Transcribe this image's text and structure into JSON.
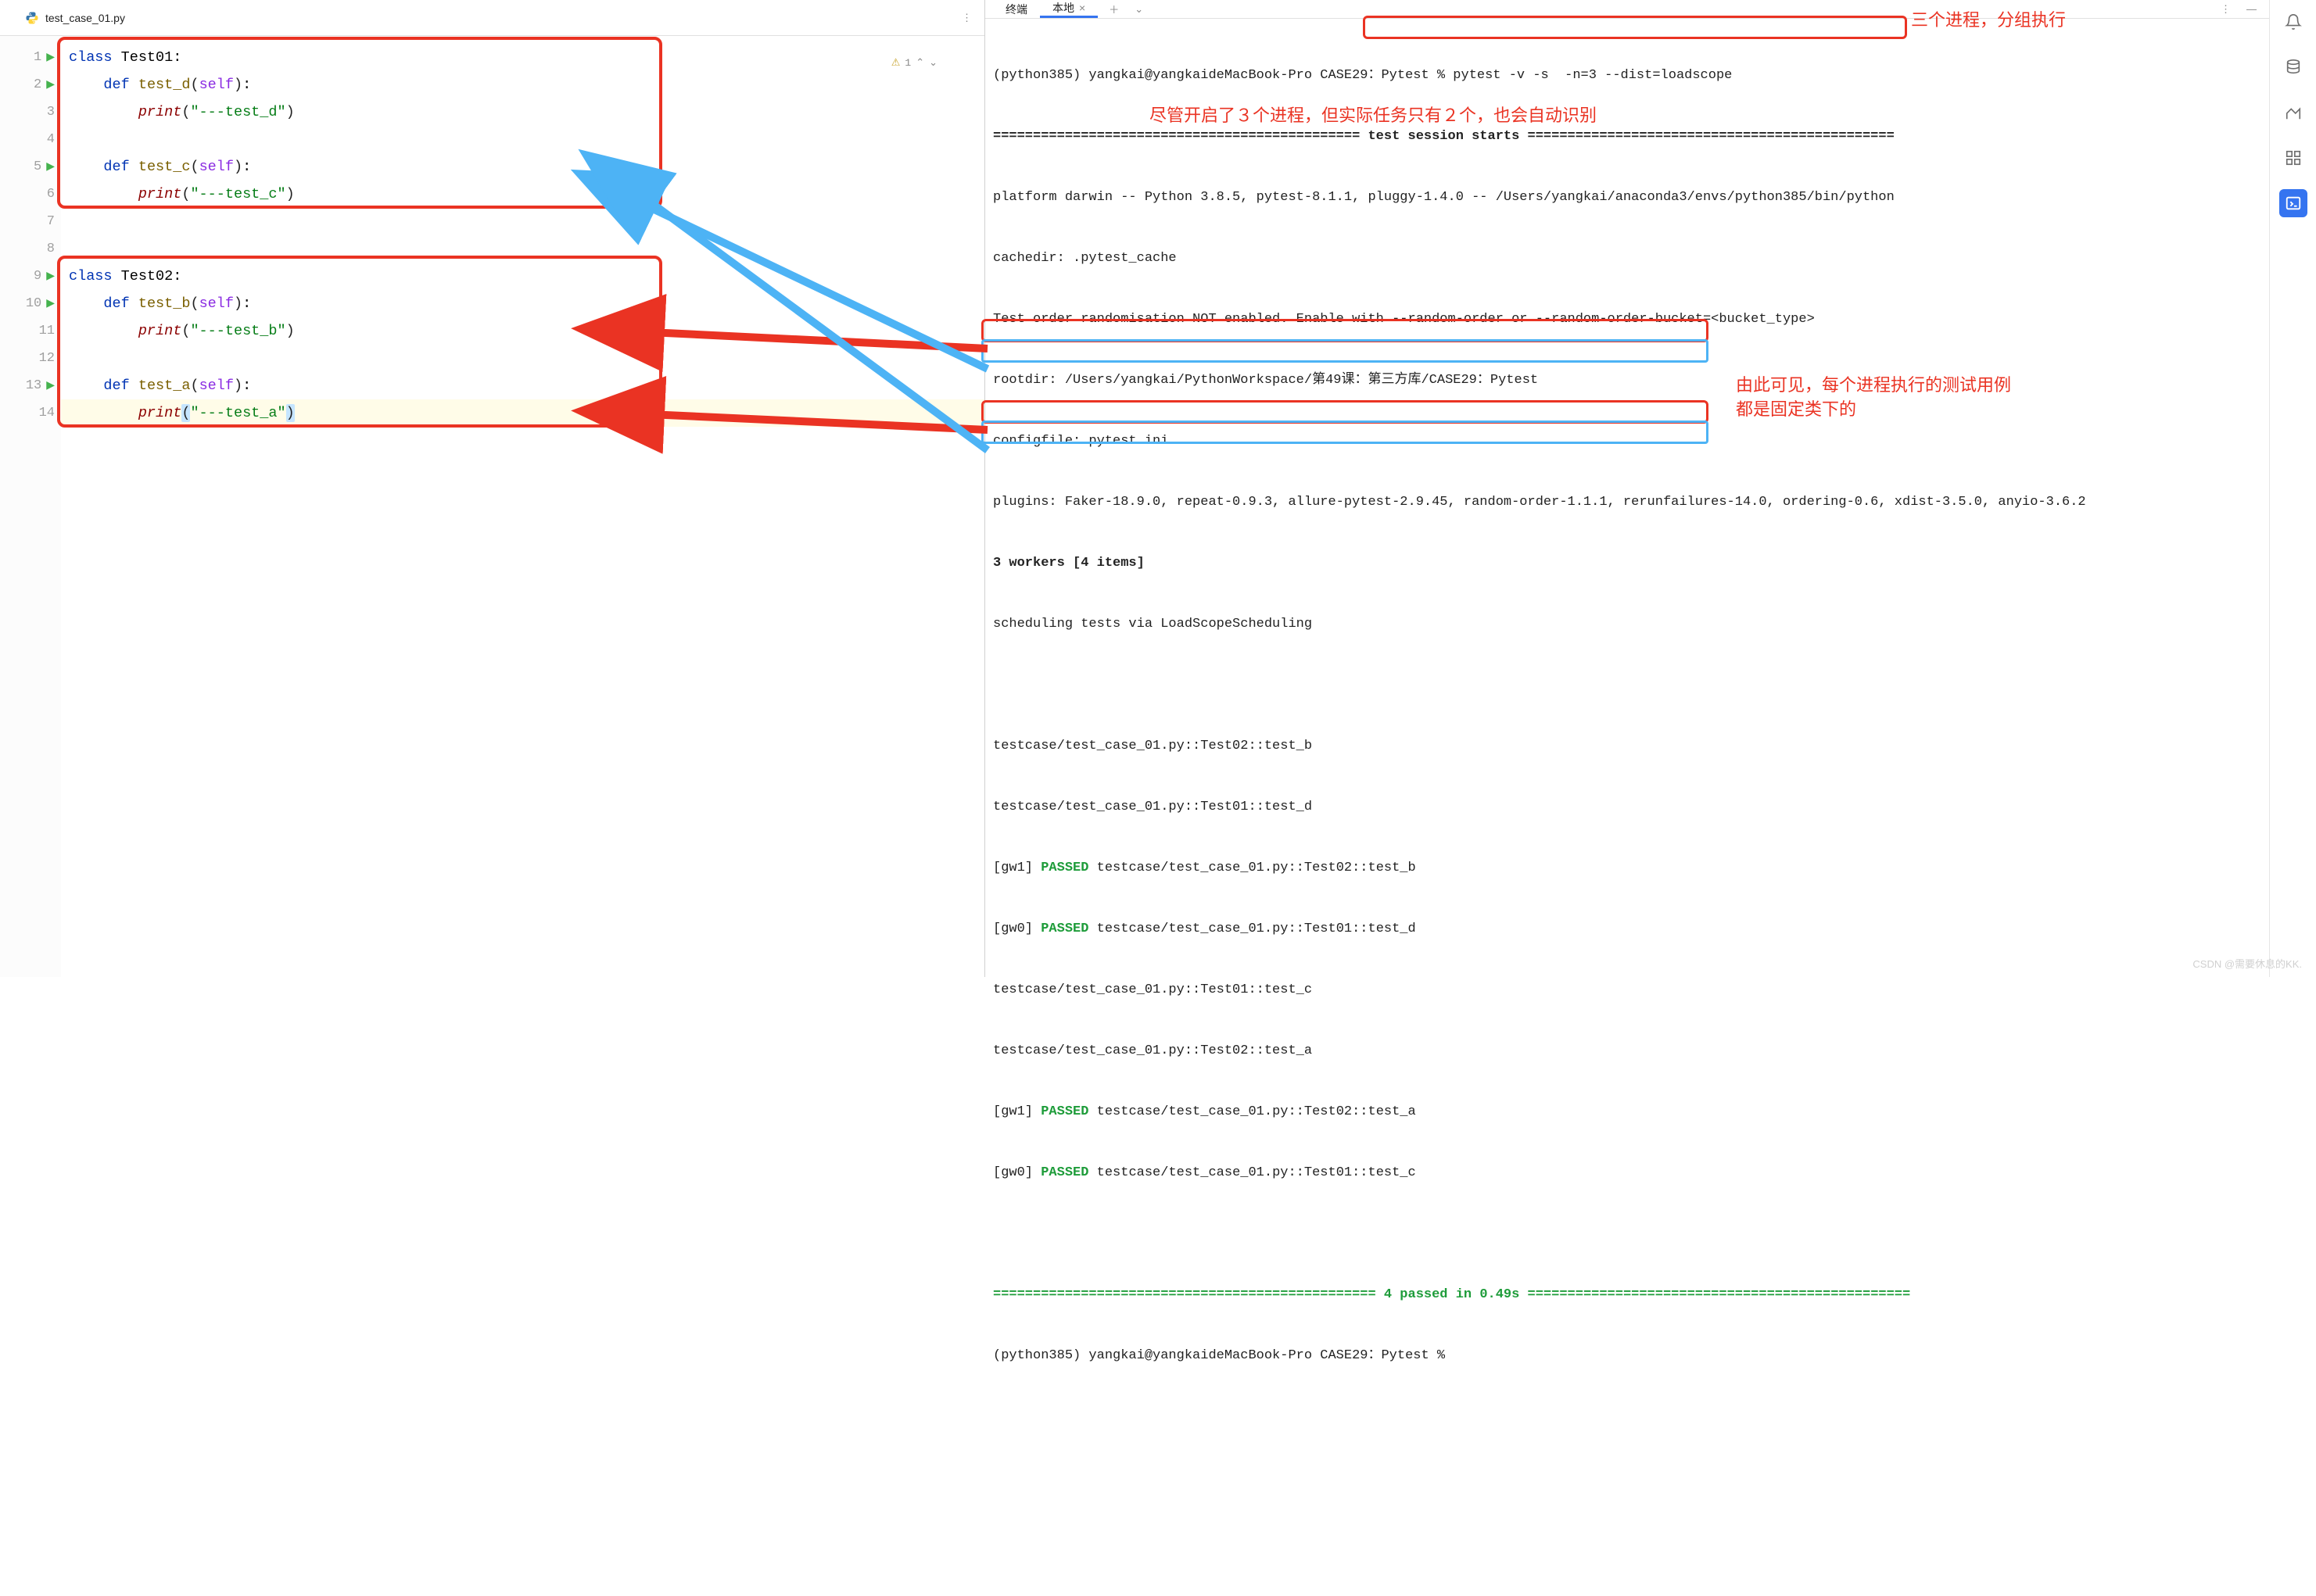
{
  "left": {
    "tab_name": "test_case_01.py",
    "inspection_count": "1",
    "lines": [
      {
        "num": "1",
        "runnable": true
      },
      {
        "num": "2",
        "runnable": true
      },
      {
        "num": "3",
        "runnable": false
      },
      {
        "num": "4",
        "runnable": false
      },
      {
        "num": "5",
        "runnable": true
      },
      {
        "num": "6",
        "runnable": false
      },
      {
        "num": "7",
        "runnable": false
      },
      {
        "num": "8",
        "runnable": false
      },
      {
        "num": "9",
        "runnable": true
      },
      {
        "num": "10",
        "runnable": true
      },
      {
        "num": "11",
        "runnable": false
      },
      {
        "num": "12",
        "runnable": false
      },
      {
        "num": "13",
        "runnable": true
      },
      {
        "num": "14",
        "runnable": false
      }
    ],
    "code": {
      "k_class": "class",
      "k_def": "def",
      "k_self": "self",
      "k_print": "print",
      "cls1": "Test01",
      "cls2": "Test02",
      "fn_d": "test_d",
      "fn_c": "test_c",
      "fn_b": "test_b",
      "fn_a": "test_a",
      "str_d": "\"---test_d\"",
      "str_c": "\"---test_c\"",
      "str_b": "\"---test_b\"",
      "str_a": "\"---test_a\"",
      "colon": ":",
      "lparen": "(",
      "rparen": ")"
    }
  },
  "right": {
    "tabs": {
      "terminal": "终端",
      "local": "本地"
    },
    "annotations": {
      "top": "三个进程，分组执行",
      "mid": "尽管开启了３个进程，但实际任务只有２个，也会自动识别",
      "right1": "由此可见，每个进程执行的测试用例",
      "right2": "都是固定类下的"
    },
    "terminal": {
      "prompt1": "(python385) yangkai@yangkaideMacBook-Pro CASE29：Pytest % ",
      "cmd": "pytest -v -s  -n=3 --dist=loadscope",
      "divider_start": "============================================== test session starts ==============================================",
      "platform": "platform darwin -- Python 3.8.5, pytest-8.1.1, pluggy-1.4.0 -- /Users/yangkai/anaconda3/envs/python385/bin/python",
      "cachedir": "cachedir: .pytest_cache",
      "random": "Test order randomisation NOT enabled. Enable with --random-order or --random-order-bucket=<bucket_type>",
      "rootdir": "rootdir: /Users/yangkai/PythonWorkspace/第49课：第三方库/CASE29：Pytest",
      "configfile": "configfile: pytest.ini",
      "plugins": "plugins: Faker-18.9.0, repeat-0.9.3, allure-pytest-2.9.45, random-order-1.1.1, rerunfailures-14.0, ordering-0.6, xdist-3.5.0, anyio-3.6.2",
      "workers": "3 workers [4 items]",
      "scheduling": "scheduling tests via LoadScopeScheduling",
      "t_b": "testcase/test_case_01.py::Test02::test_b",
      "t_d": "testcase/test_case_01.py::Test01::test_d",
      "gw1_b_pre": "[gw1] ",
      "passed": "PASSED",
      "gw1_b_post": " testcase/test_case_01.py::Test02::test_b",
      "gw0_d_pre": "[gw0] ",
      "gw0_d_post": " testcase/test_case_01.py::Test01::test_d",
      "t_c": "testcase/test_case_01.py::Test01::test_c",
      "t_a": "testcase/test_case_01.py::Test02::test_a",
      "gw1_a_pre": "[gw1] ",
      "gw1_a_post": " testcase/test_case_01.py::Test02::test_a",
      "gw0_c_pre": "[gw0] ",
      "gw0_c_post": " testcase/test_case_01.py::Test01::test_c",
      "divider_end_pre": "================================================ ",
      "passed_count": "4 passed",
      "divider_end_post": " in 0.49s ================================================",
      "prompt2": "(python385) yangkai@yangkaideMacBook-Pro CASE29：Pytest % "
    }
  },
  "watermark": "CSDN @需要休息的KK."
}
